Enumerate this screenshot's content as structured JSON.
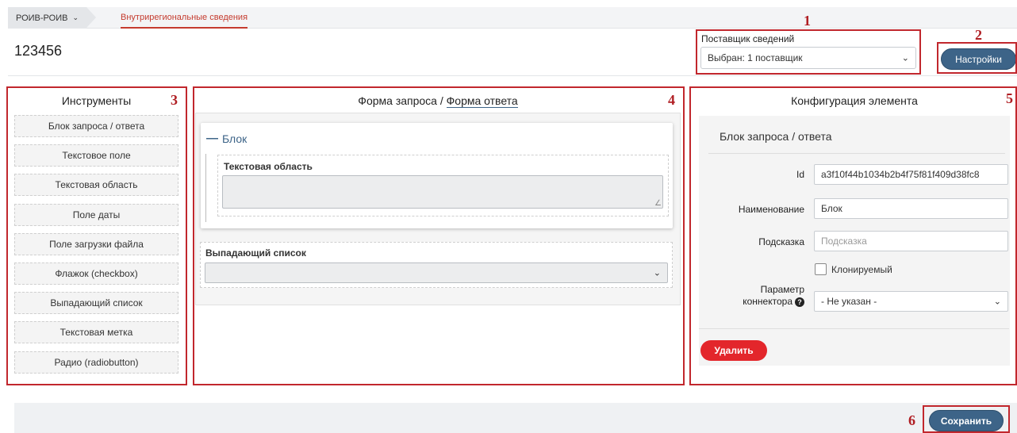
{
  "breadcrumb": {
    "root": "РОИВ-РОИВ",
    "active": "Внутрирегиональные сведения"
  },
  "page": {
    "id": "123456"
  },
  "supplier": {
    "label": "Поставщик сведений",
    "selected": "Выбран: 1 поставщик"
  },
  "buttons": {
    "settings": "Настройки",
    "delete": "Удалить",
    "save": "Сохранить"
  },
  "tools": {
    "title": "Инструменты",
    "items": [
      "Блок запроса / ответа",
      "Текстовое поле",
      "Текстовая область",
      "Поле даты",
      "Поле загрузки файла",
      "Флажок (checkbox)",
      "Выпадающий список",
      "Текстовая метка",
      "Радио (radiobutton)"
    ]
  },
  "form": {
    "title_request": "Форма запроса",
    "title_sep": " / ",
    "title_response": "Форма ответа",
    "block_title": "Блок",
    "textarea_label": "Текстовая область",
    "dropdown_label": "Выпадающий список"
  },
  "config": {
    "title": "Конфигурация элемента",
    "subtitle": "Блок запроса / ответа",
    "id_label": "Id",
    "id_value": "a3f10f44b1034b2b4f75f81f409d38fc8",
    "name_label": "Наименование",
    "name_value": "Блок",
    "hint_label": "Подсказка",
    "hint_placeholder": "Подсказка",
    "clone_label": "Клонируемый",
    "clone_checked": false,
    "connector_label_1": "Параметр",
    "connector_label_2": "коннектора",
    "connector_value": "- Не указан -"
  },
  "annotations": [
    "1",
    "2",
    "3",
    "4",
    "5",
    "6"
  ],
  "colors": {
    "primary": "#3d6488",
    "danger": "#e3262b",
    "annotation": "#c1272d",
    "link_active": "#c53b2e"
  }
}
